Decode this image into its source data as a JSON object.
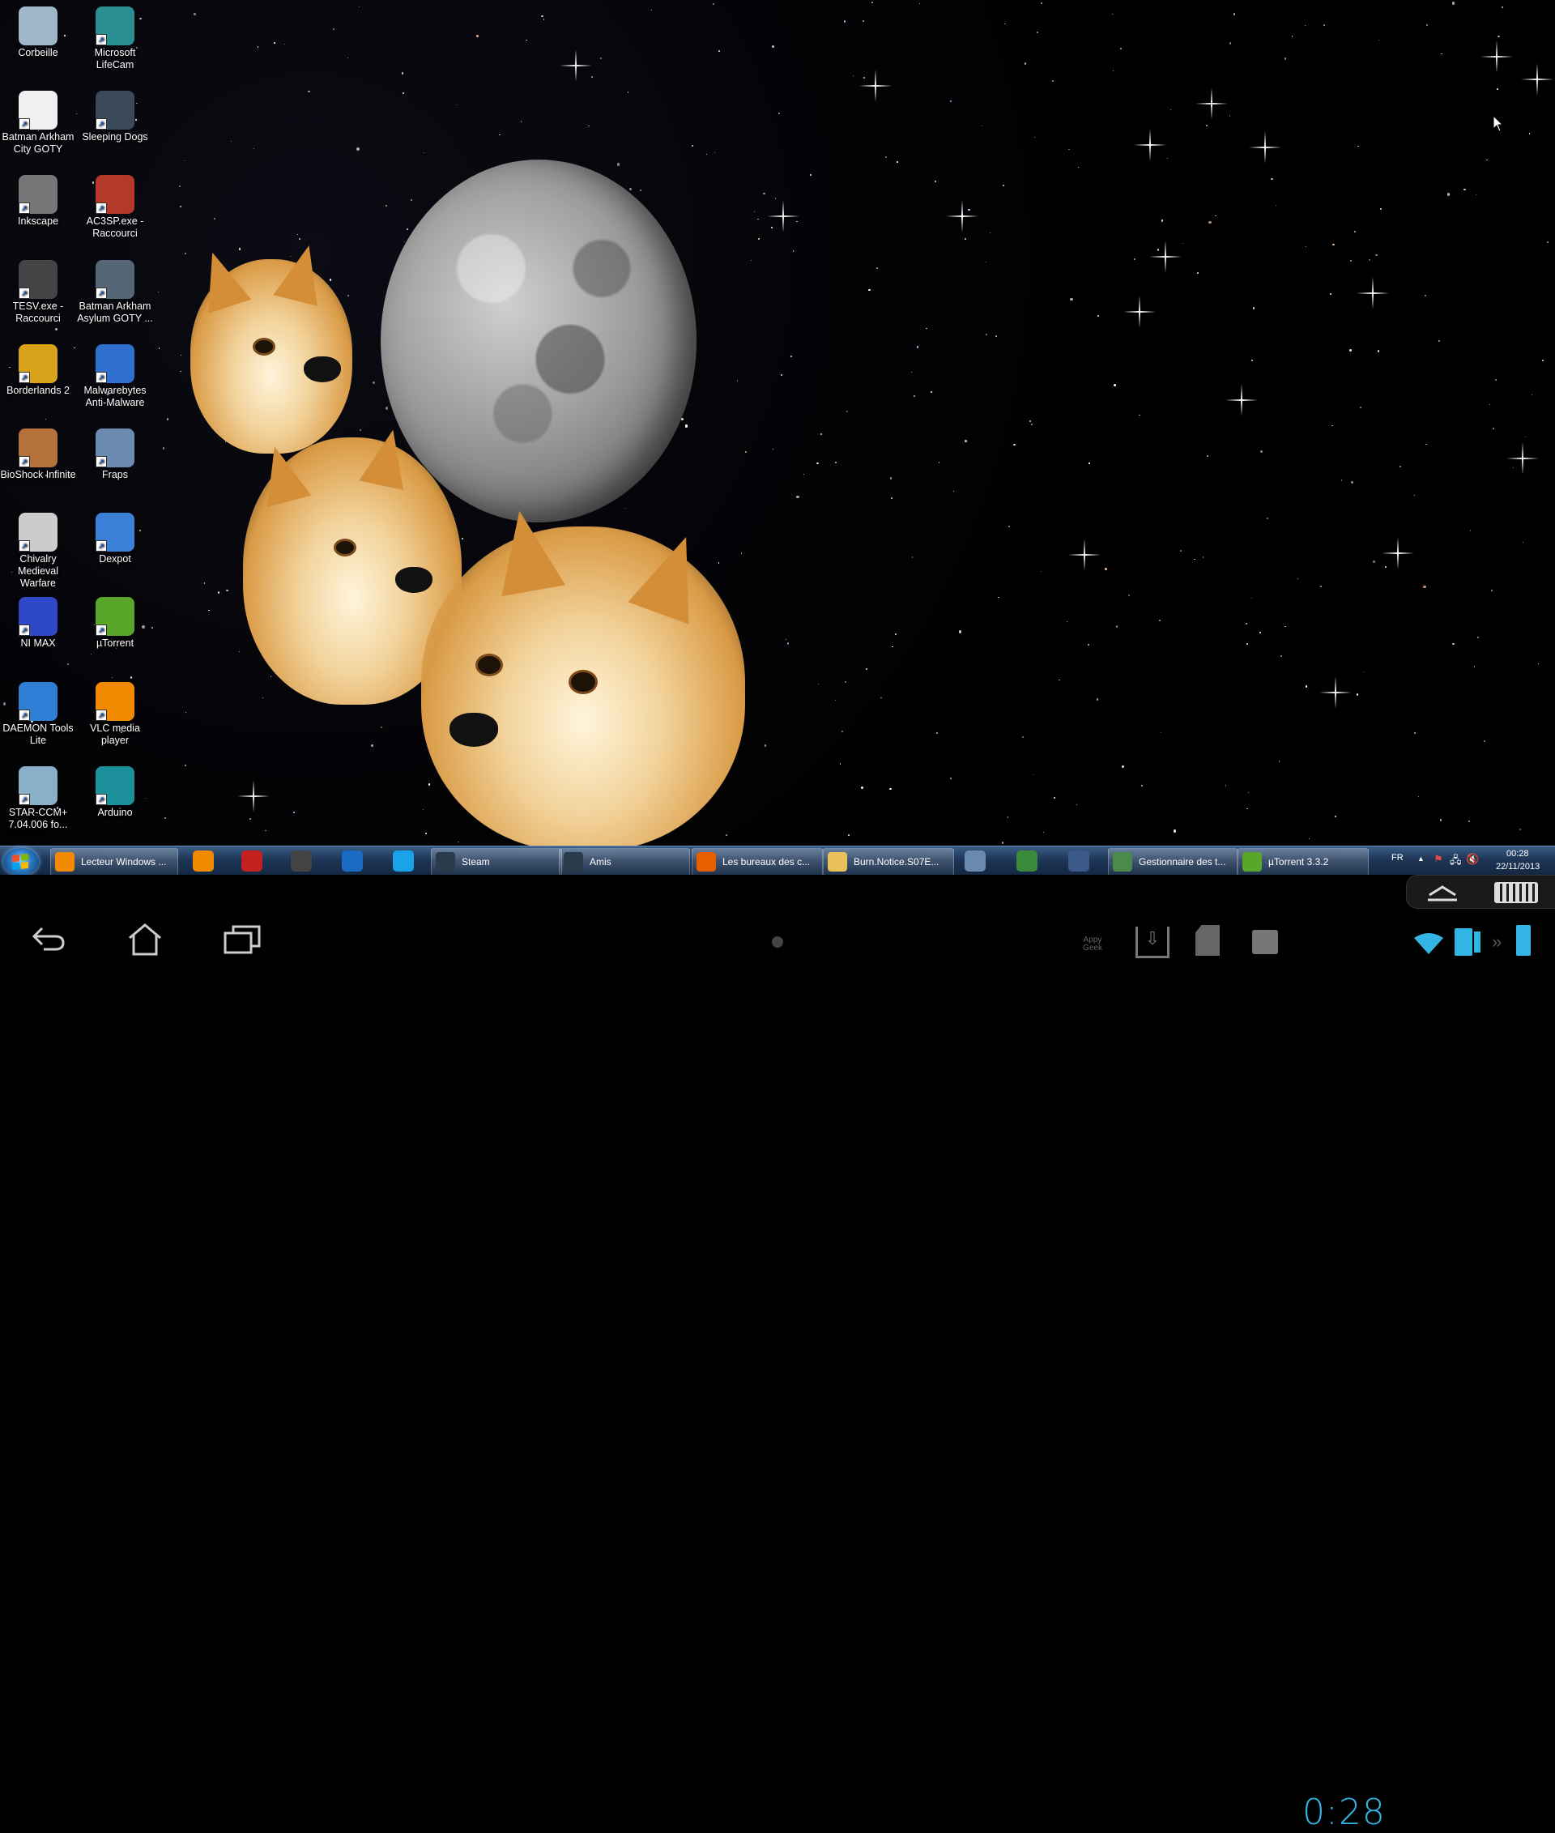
{
  "desktop": {
    "icons": [
      {
        "label": "Corbeille",
        "icon": "recycle-bin-icon",
        "color": "#9fb7c9"
      },
      {
        "label": "Microsoft LifeCam",
        "icon": "webcam-icon",
        "color": "#2a8f93"
      },
      {
        "label": "Batman Arkham City GOTY",
        "icon": "file-icon",
        "color": "#f0f0f0"
      },
      {
        "label": "Sleeping Dogs",
        "icon": "game-icon",
        "color": "#3a4a5a"
      },
      {
        "label": "Inkscape",
        "icon": "inkscape-icon",
        "color": "#777777"
      },
      {
        "label": "AC3SP.exe - Raccourci",
        "icon": "game-icon",
        "color": "#b33a2a"
      },
      {
        "label": "TESV.exe - Raccourci",
        "icon": "skyrim-icon",
        "color": "#444444"
      },
      {
        "label": "Batman Arkham Asylum GOTY ...",
        "icon": "game-icon",
        "color": "#556677"
      },
      {
        "label": "Borderlands 2",
        "icon": "game-icon",
        "color": "#d8a21a"
      },
      {
        "label": "Malwarebytes Anti-Malware",
        "icon": "shield-icon",
        "color": "#2f6fcf"
      },
      {
        "label": "BioShock Infinite",
        "icon": "game-icon",
        "color": "#b5713a"
      },
      {
        "label": "Fraps",
        "icon": "fraps-icon",
        "color": "#6a8ab0"
      },
      {
        "label": "Chivalry Medieval Warfare",
        "icon": "game-icon",
        "color": "#cccccc"
      },
      {
        "label": "Dexpot",
        "icon": "desktops-icon",
        "color": "#3b7fd6"
      },
      {
        "label": "NI MAX",
        "icon": "ni-max-icon",
        "color": "#2f48c7"
      },
      {
        "label": "µTorrent",
        "icon": "utorrent-icon",
        "color": "#5aa62a"
      },
      {
        "label": "DAEMON Tools Lite",
        "icon": "daemon-tools-icon",
        "color": "#2f7ed6"
      },
      {
        "label": "VLC media player",
        "icon": "vlc-icon",
        "color": "#f08a00"
      },
      {
        "label": "STAR-CCM+ 7.04.006 fo...",
        "icon": "app-icon",
        "color": "#88b0c8"
      },
      {
        "label": "Arduino",
        "icon": "arduino-icon",
        "color": "#1b8f9a"
      }
    ]
  },
  "taskbar": {
    "items": [
      {
        "label": "Lecteur Windows ...",
        "icon": "media-player-icon",
        "color": "#f08a00",
        "type": "window"
      },
      {
        "label": "",
        "icon": "vlc-icon",
        "color": "#f08a00",
        "type": "pin"
      },
      {
        "label": "",
        "icon": "rockstar-icon",
        "color": "#c42020",
        "type": "pin"
      },
      {
        "label": "",
        "icon": "skyrim-icon",
        "color": "#444444",
        "type": "pin"
      },
      {
        "label": "",
        "icon": "uplay-icon",
        "color": "#1a6bc2",
        "type": "pin"
      },
      {
        "label": "",
        "icon": "skype-icon",
        "color": "#1aa3e8",
        "type": "pin"
      },
      {
        "label": "Steam",
        "icon": "steam-icon",
        "color": "#2a3b4c",
        "type": "window"
      },
      {
        "label": "Amis",
        "icon": "steam-icon",
        "color": "#2a3b4c",
        "type": "window"
      },
      {
        "label": "Les bureaux des c...",
        "icon": "firefox-icon",
        "color": "#e66000",
        "type": "window"
      },
      {
        "label": "Burn.Notice.S07E...",
        "icon": "folder-icon",
        "color": "#e8c15a",
        "type": "window"
      },
      {
        "label": "",
        "icon": "fraps-icon",
        "color": "#6a8ab0",
        "type": "pin"
      },
      {
        "label": "",
        "icon": "network-icon",
        "color": "#3a8a3a",
        "type": "pin"
      },
      {
        "label": "",
        "icon": "dexpot-icon",
        "color": "#3b5a8a",
        "type": "pin"
      },
      {
        "label": "Gestionnaire des t...",
        "icon": "task-manager-icon",
        "color": "#4a8a4a",
        "type": "window"
      },
      {
        "label": "µTorrent 3.3.2",
        "icon": "utorrent-icon",
        "color": "#5aa62a",
        "type": "window"
      }
    ],
    "tray": {
      "lang": "FR",
      "time": "00:28",
      "date": "22/11/2013"
    }
  },
  "android": {
    "clock": "0:28",
    "brand": "Appy Geek",
    "accent": "#33b5e5"
  }
}
